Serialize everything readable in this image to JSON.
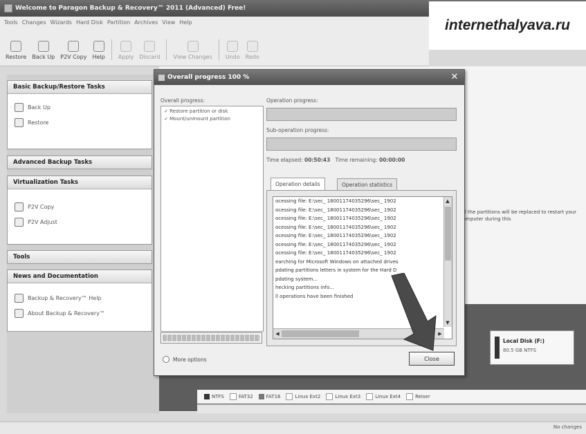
{
  "app": {
    "title": "Welcome to Paragon Backup & Recovery™ 2011 (Advanced) Free!",
    "watermark": "internethalyava.ru"
  },
  "menu": [
    "Tools",
    "Changes",
    "Wizards",
    "Hard Disk",
    "Partition",
    "Archives",
    "View",
    "Help"
  ],
  "toolbar": {
    "buttons": [
      {
        "label": "Restore",
        "icon": "restore-icon"
      },
      {
        "label": "Back Up",
        "icon": "backup-icon"
      },
      {
        "label": "P2V Copy",
        "icon": "p2v-copy-icon"
      },
      {
        "label": "Help",
        "icon": "help-icon"
      },
      {
        "label": "Apply",
        "icon": "apply-icon"
      },
      {
        "label": "Discard",
        "icon": "discard-icon"
      },
      {
        "label": "View Changes",
        "icon": "view-changes-icon"
      },
      {
        "label": "Undo",
        "icon": "undo-icon"
      },
      {
        "label": "Redo",
        "icon": "redo-icon"
      }
    ]
  },
  "sidebar": {
    "basic": {
      "title": "Basic Backup/Restore Tasks",
      "items": [
        "Back Up",
        "Restore"
      ]
    },
    "advanced": {
      "title": "Advanced Backup Tasks"
    },
    "virtualization": {
      "title": "Virtualization Tasks",
      "items": [
        "P2V Copy",
        "P2V Adjust"
      ]
    },
    "tools": {
      "title": "Tools"
    },
    "news": {
      "title": "News and Documentation",
      "items": [
        "Backup & Recovery™ Help",
        "About Backup & Recovery™"
      ]
    }
  },
  "main": {
    "info_text": "All the partitions will be replaced to restart your computer during this",
    "disk": {
      "label": "Local Disk (F:)",
      "size": "80.5 GB NTFS"
    },
    "legend": [
      "NTFS",
      "FAT32",
      "FAT16",
      "Linux Ext2",
      "Linux Ext3",
      "Linux Ext4",
      "Reiser"
    ],
    "status": "No changes"
  },
  "dialog": {
    "title": "Overall progress 100 %",
    "overall_label": "Overall progress:",
    "steps": [
      "Restore partition or disk",
      "Mount/unmount partition"
    ],
    "operation_label": "Operation progress:",
    "suboperation_label": "Sub-operation progress:",
    "time_elapsed_label": "Time elapsed:",
    "time_elapsed": "00:50:43",
    "time_remaining_label": "Time remaining:",
    "time_remaining": "00:00:00",
    "tabs": [
      "Operation details",
      "Operation statistics"
    ],
    "log": [
      "ocessing file: E:\\sec_ 18001174035296\\sec_ 1902",
      "ocessing file: E:\\sec_ 18001174035296\\sec_ 1902",
      "ocessing file: E:\\sec_ 18001174035296\\sec_ 1902",
      "ocessing file: E:\\sec_ 18001174035296\\sec_ 1902",
      "ocessing file: E:\\sec_ 18001174035296\\sec_ 1902",
      "ocessing file: E:\\sec_ 18001174035296\\sec_ 1902",
      "ocessing file: E:\\sec_ 18001174035296\\sec_ 1902",
      "earching for Microsoft Windows on attached drives",
      "pdating partitions letters in system for the Hard D",
      "pdating system...",
      "hecking partitions info...",
      "ll operations have been finished"
    ],
    "more_options": "More options",
    "close_button": "Close"
  }
}
